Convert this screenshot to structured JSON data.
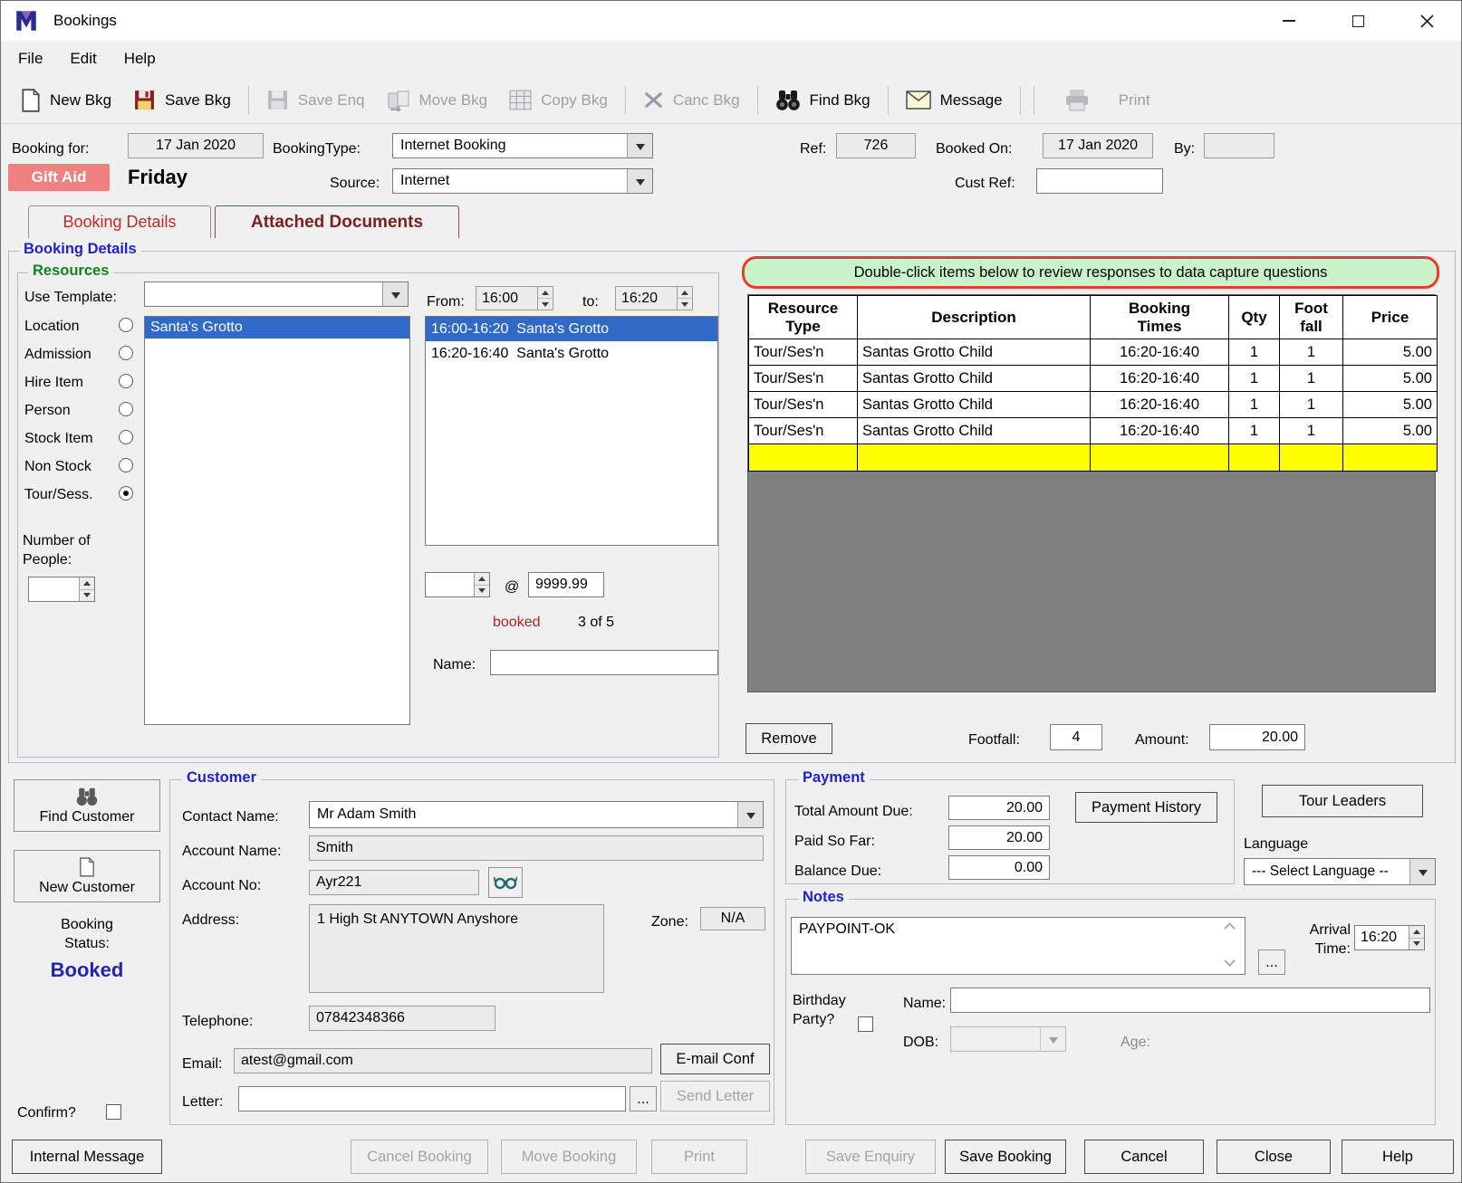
{
  "colors": {
    "selection_blue": "#316ac5",
    "gift_aid_pink": "#ef8181",
    "banner_green_bg": "#c9f3c9",
    "banner_red_border": "#ee3b23",
    "highlight_row_yellow": "#ffff00",
    "empty_grid_gray": "#808080",
    "tab_red": "#c62828",
    "attached_tab_maroon": "#7b1f1f",
    "group_title_blue": "#2121cc",
    "group_title_green": "#15801e",
    "status_booked_blue": "#2424b0",
    "booked_count_red": "#b22222"
  },
  "window": {
    "title": "Bookings",
    "menu": [
      "File",
      "Edit",
      "Help"
    ]
  },
  "toolbar": {
    "items": [
      {
        "label": "New Bkg",
        "icon": "new-booking-icon",
        "enabled": true
      },
      {
        "label": "Save Bkg",
        "icon": "save-booking-icon",
        "enabled": true
      },
      {
        "label": "Save Enq",
        "icon": "save-enquiry-icon",
        "enabled": false
      },
      {
        "label": "Move Bkg",
        "icon": "move-booking-icon",
        "enabled": false
      },
      {
        "label": "Copy Bkg",
        "icon": "copy-booking-icon",
        "enabled": false
      },
      {
        "label": "Canc Bkg",
        "icon": "cancel-booking-icon",
        "enabled": false
      },
      {
        "label": "Find Bkg",
        "icon": "find-booking-icon",
        "enabled": true
      },
      {
        "label": "Message",
        "icon": "message-icon",
        "enabled": true
      },
      {
        "label": "Print",
        "icon": "print-icon",
        "enabled": false
      }
    ]
  },
  "header": {
    "booking_for_label": "Booking for:",
    "booking_date": "17 Jan 2020",
    "gift_aid_label": "Gift Aid",
    "day_name": "Friday",
    "booking_type_label": "BookingType:",
    "booking_type_value": "Internet Booking",
    "source_label": "Source:",
    "source_value": "Internet",
    "ref_label": "Ref:",
    "ref_value": "726",
    "booked_on_label": "Booked On:",
    "booked_on_value": "17 Jan 2020",
    "by_label": "By:",
    "by_value": "",
    "cust_ref_label": "Cust Ref:",
    "cust_ref_value": ""
  },
  "tabs": [
    {
      "label": "Booking Details",
      "active": true
    },
    {
      "label": "Attached Documents",
      "active": false
    }
  ],
  "booking_details": {
    "group_title": "Booking Details",
    "resources": {
      "group_title": "Resources",
      "use_template_label": "Use Template:",
      "template_value": "",
      "categories": [
        {
          "label": "Location",
          "selected": false
        },
        {
          "label": "Admission",
          "selected": false
        },
        {
          "label": "Hire Item",
          "selected": false
        },
        {
          "label": "Person",
          "selected": false
        },
        {
          "label": "Stock Item",
          "selected": false
        },
        {
          "label": "Non Stock",
          "selected": false
        },
        {
          "label": "Tour/Sess.",
          "selected": true
        }
      ],
      "number_of_people_label": "Number of\nPeople:",
      "number_of_people_value": "",
      "resource_list": [
        "Santa's Grotto"
      ],
      "from_label": "From:",
      "from_time": "16:00",
      "to_label": "to:",
      "to_time": "16:20",
      "sessions": [
        {
          "label": "16:00-16:20  Santa's Grotto",
          "selected": true
        },
        {
          "label": "16:20-16:40  Santa's Grotto",
          "selected": false
        }
      ],
      "qty_value": "",
      "at_sign": "@",
      "max_price": "9999.99",
      "booked_label": "booked",
      "booked_count": "3 of 5",
      "name_label": "Name:",
      "name_value": ""
    },
    "capture": {
      "banner": "Double-click items below to review responses to data capture questions",
      "table": {
        "headers": [
          "Resource\nType",
          "Description",
          "Booking\nTimes",
          "Qty",
          "Foot\nfall",
          "Price"
        ],
        "rows": [
          [
            "Tour/Ses'n",
            "Santas Grotto Child",
            "16:20-16:40",
            "1",
            "1",
            "5.00"
          ],
          [
            "Tour/Ses'n",
            "Santas Grotto Child",
            "16:20-16:40",
            "1",
            "1",
            "5.00"
          ],
          [
            "Tour/Ses'n",
            "Santas Grotto Child",
            "16:20-16:40",
            "1",
            "1",
            "5.00"
          ],
          [
            "Tour/Ses'n",
            "Santas Grotto Child",
            "16:20-16:40",
            "1",
            "1",
            "5.00"
          ]
        ]
      },
      "remove_button": "Remove",
      "footfall_label": "Footfall:",
      "footfall_value": "4",
      "amount_label": "Amount:",
      "amount_value": "20.00"
    }
  },
  "customer": {
    "group_title": "Customer",
    "find_customer_button": "Find Customer",
    "new_customer_button": "New Customer",
    "booking_status_label": "Booking\nStatus:",
    "booking_status_value": "Booked",
    "confirm_label": "Confirm?",
    "contact_name_label": "Contact Name:",
    "contact_name_value": "Mr Adam Smith",
    "account_name_label": "Account Name:",
    "account_name_value": "Smith",
    "account_no_label": "Account No:",
    "account_no_value": "Ayr221",
    "address_label": "Address:",
    "address_value": "1 High St\nANYTOWN\nAnyshore",
    "zone_label": "Zone:",
    "zone_value": "N/A",
    "telephone_label": "Telephone:",
    "telephone_value": "07842348366",
    "email_label": "Email:",
    "email_value": "atest@gmail.com",
    "email_conf_button": "E-mail Conf",
    "letter_label": "Letter:",
    "letter_value": "",
    "browse_button": "...",
    "send_letter_button": "Send Letter"
  },
  "payment": {
    "group_title": "Payment",
    "total_amount_due_label": "Total Amount Due:",
    "total_amount_due_value": "20.00",
    "paid_so_far_label": "Paid So Far:",
    "paid_so_far_value": "20.00",
    "balance_due_label": "Balance Due:",
    "balance_due_value": "0.00",
    "payment_history_button": "Payment History",
    "tour_leaders_button": "Tour Leaders",
    "language_label": "Language",
    "language_value": "--- Select Language --"
  },
  "notes": {
    "group_title": "Notes",
    "notes_value": "PAYPOINT-OK",
    "browse_button": "...",
    "arrival_time_label": "Arrival\nTime:",
    "arrival_time_value": "16:20",
    "birthday_party_label": "Birthday\nParty?",
    "name_label": "Name:",
    "name_value": "",
    "dob_label": "DOB:",
    "age_label": "Age:"
  },
  "footer_buttons": [
    {
      "label": "Internal Message",
      "enabled": true
    },
    {
      "label": "Cancel Booking",
      "enabled": false
    },
    {
      "label": "Move Booking",
      "enabled": false
    },
    {
      "label": "Print",
      "enabled": false
    },
    {
      "label": "Save Enquiry",
      "enabled": false
    },
    {
      "label": "Save Booking",
      "enabled": true
    },
    {
      "label": "Cancel",
      "enabled": true
    },
    {
      "label": "Close",
      "enabled": true
    },
    {
      "label": "Help",
      "enabled": true
    }
  ]
}
